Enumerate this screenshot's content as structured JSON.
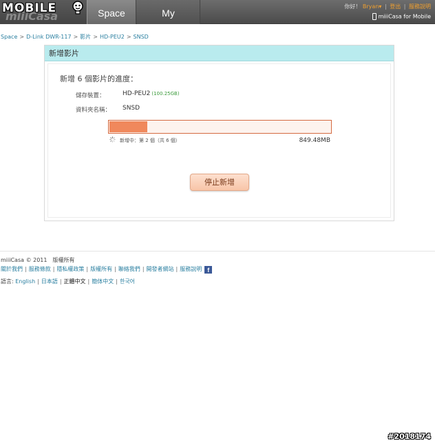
{
  "watermark": {
    "top": "MOBILE",
    "bottom": "#2018174"
  },
  "header": {
    "logo": "miiiCasa",
    "tabs": [
      {
        "label": "Space",
        "active": true
      },
      {
        "label": "My Account",
        "active": false
      }
    ],
    "greeting": "你好！",
    "user": "Bryan",
    "logout": "登出",
    "help": "服務說明",
    "mobile_link": "miiiCasa for Mobile"
  },
  "breadcrumb": [
    "Space",
    "D-Link DWR-117",
    "影片",
    "HD-PEU2",
    "SNSD"
  ],
  "panel": {
    "title": "新增影片",
    "progress_title": "新增 6 個影片的進度：",
    "device_label": "儲存裝置：",
    "device_value": "HD-PEU2",
    "device_capacity": "(100.25GB)",
    "folder_label": "資料夾名稱：",
    "folder_value": "SNSD",
    "progress_fraction": 0.17,
    "status_text": "新增中：第 2 個（共 6 個）",
    "size_text": "849.48MB",
    "stop_button": "停止新增"
  },
  "footer": {
    "copyright": "miiiCasa © 2011　版權所有",
    "links": [
      "關於我們",
      "服務條款",
      "隱私權政策",
      "版權所有",
      "聯絡我們",
      "開發者網站",
      "服務說明"
    ],
    "facebook": "f",
    "language_label": "語言:",
    "languages": [
      {
        "label": "English",
        "current": false
      },
      {
        "label": "日本語",
        "current": false
      },
      {
        "label": "正體中文",
        "current": true
      },
      {
        "label": "簡体中文",
        "current": false
      },
      {
        "label": "한국어",
        "current": false
      }
    ]
  },
  "colors": {
    "panel_header": "#b9ebee",
    "progress_fill": "#f0885c",
    "link": "#2a7fa0",
    "accent": "#f0a030"
  }
}
